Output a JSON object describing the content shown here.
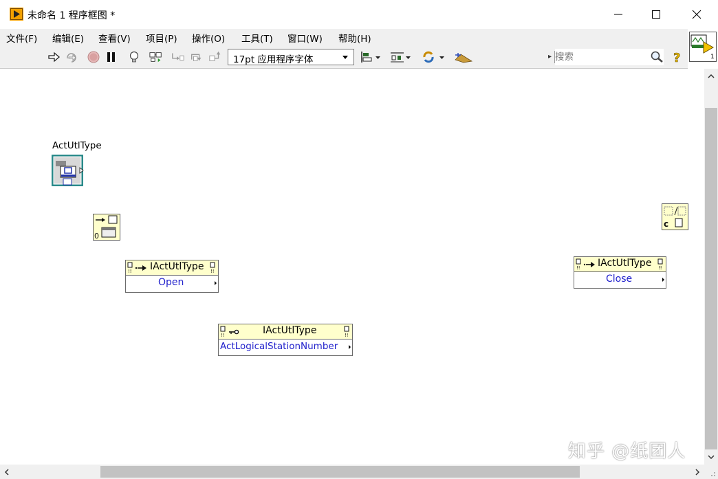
{
  "window": {
    "title": "未命名 1 程序框图 *"
  },
  "menu": {
    "items": [
      {
        "label": "文件(F)"
      },
      {
        "label": "编辑(E)"
      },
      {
        "label": "查看(V)"
      },
      {
        "label": "项目(P)"
      },
      {
        "label": "操作(O)"
      },
      {
        "label": "工具(T)"
      },
      {
        "label": "窗口(W)"
      },
      {
        "label": "帮助(H)"
      }
    ]
  },
  "toolbar": {
    "font_selector_value": "17pt 应用程序字体",
    "search_placeholder": "搜索",
    "icons": [
      "run-icon",
      "run-continuously-icon",
      "abort-icon",
      "pause-icon",
      "highlight-execution-icon",
      "retain-wire-values-icon",
      "step-into-icon",
      "step-over-icon",
      "step-out-icon",
      "align-objects-icon",
      "distribute-objects-icon",
      "reorder-icon",
      "cleanup-diagram-icon",
      "search-icon",
      "help-icon"
    ]
  },
  "diagram": {
    "activex_control_label": "ActUtlType",
    "open_node": {
      "class": "IActUtlType",
      "method": "Open"
    },
    "close_node": {
      "class": "IActUtlType",
      "method": "Close"
    },
    "property_node": {
      "class": "IActUtlType",
      "property": "ActLogicalStationNumber"
    }
  },
  "watermark": "知乎 @纸团人",
  "colors": {
    "node_header": "#ffffcc",
    "method_text": "#2222cc",
    "refnum_teal": "#2a8a8a"
  }
}
